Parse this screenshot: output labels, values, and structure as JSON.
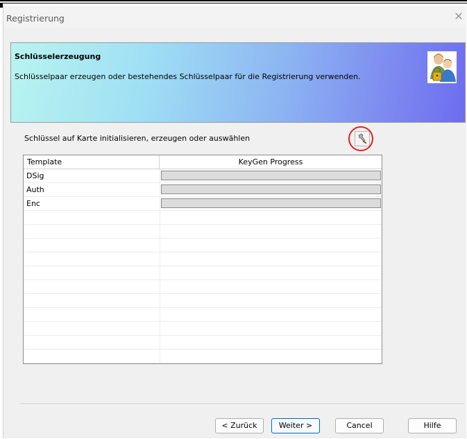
{
  "window": {
    "title": "Registrierung",
    "close_symbol": "✕"
  },
  "banner": {
    "title": "Schlüsselerzeugung",
    "description": "Schlüsselpaar erzeugen oder bestehendes Schlüsselpaar für die Registrierung verwenden.",
    "icon": "users-keys-icon"
  },
  "instruction": "Schlüssel auf Karte initialisieren, erzeugen oder auswählen",
  "tool_button": {
    "icon": "key-tool-icon"
  },
  "table": {
    "columns": [
      "Template",
      "KeyGen Progress"
    ],
    "rows": [
      {
        "template": "DSig",
        "progress": 0
      },
      {
        "template": "Auth",
        "progress": 0
      },
      {
        "template": "Enc",
        "progress": 0
      }
    ],
    "empty_rows": 12
  },
  "buttons": {
    "back": "< Zurück",
    "next": "Weiter >",
    "cancel": "Cancel",
    "help": "Hilfe"
  },
  "colors": {
    "highlight_circle": "#e02020",
    "default_button_border": "#0067c0"
  }
}
